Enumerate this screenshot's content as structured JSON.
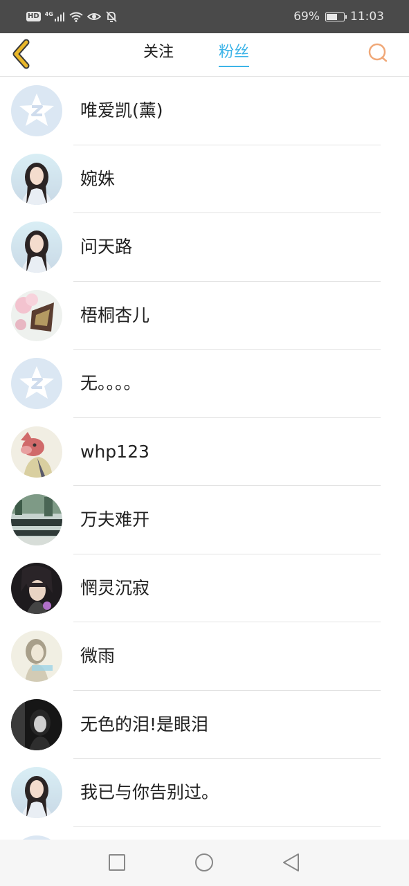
{
  "status_bar": {
    "left_icons": [
      "hd-icon",
      "signal-4g-icon",
      "wifi-icon",
      "eye-icon",
      "mute-icon"
    ],
    "hd_label": "HD",
    "network_label": "4G",
    "battery_level": 0.69,
    "battery_text": "69%",
    "time": "11:03"
  },
  "header": {
    "back_icon": "chevron-left-icon",
    "tabs": [
      {
        "label": "关注",
        "active": false
      },
      {
        "label": "粉丝",
        "active": true
      }
    ],
    "search_icon": "search-icon",
    "accent_color": "#3db4e8",
    "back_color": "#e9b72a",
    "search_color": "#f0a878"
  },
  "fans": [
    {
      "name": "唯爱凯(薰)",
      "avatar": "default-qq-avatar"
    },
    {
      "name": "婉姝",
      "avatar": "girl-photo-avatar"
    },
    {
      "name": "问天路",
      "avatar": "girl-photo-avatar"
    },
    {
      "name": "梧桐杏儿",
      "avatar": "flower-photo-avatar"
    },
    {
      "name": "无。。。。",
      "avatar": "default-qq-avatar"
    },
    {
      "name": "whp123",
      "avatar": "cartoon-fox-avatar"
    },
    {
      "name": "万夫难开",
      "avatar": "scenery-photo-avatar"
    },
    {
      "name": "惘灵沉寂",
      "avatar": "anime-boy-avatar"
    },
    {
      "name": "微雨",
      "avatar": "sketch-girl-avatar"
    },
    {
      "name": "无色的泪!是眼泪",
      "avatar": "dark-photo-avatar"
    },
    {
      "name": "我已与你告别过。",
      "avatar": "girl-photo-avatar"
    }
  ],
  "nav_bar": {
    "buttons": [
      "recent-apps-icon",
      "home-icon",
      "back-triangle-icon"
    ]
  }
}
